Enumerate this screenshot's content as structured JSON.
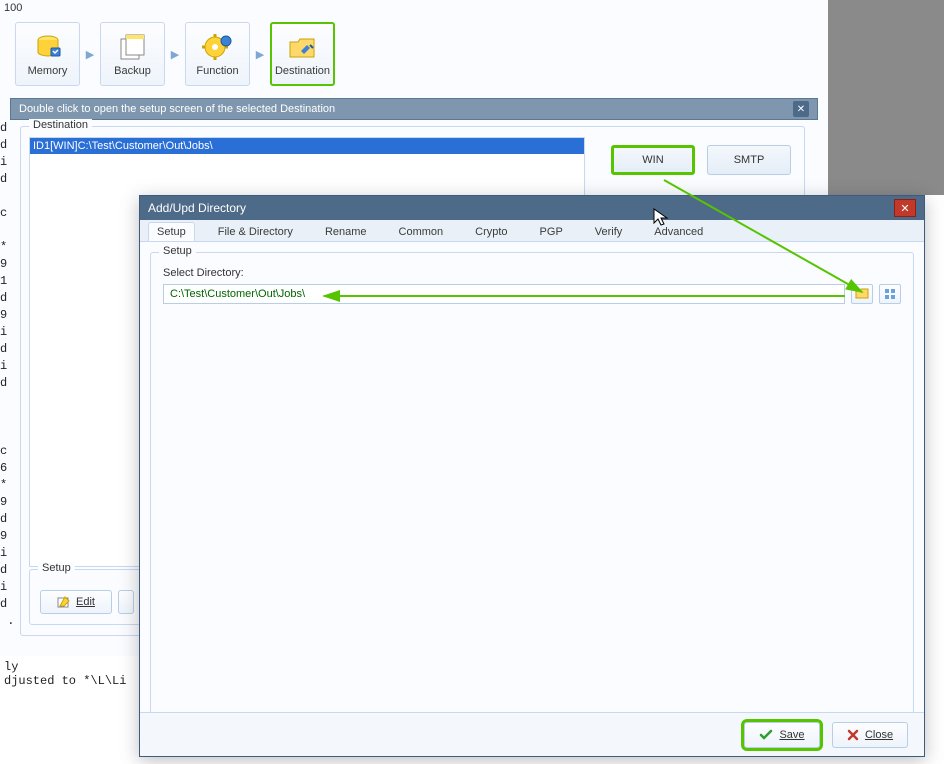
{
  "top_label": "100",
  "toolbar": [
    {
      "label": "Memory"
    },
    {
      "label": "Backup"
    },
    {
      "label": "Function"
    },
    {
      "label": "Destination"
    }
  ],
  "panel_info": "Double click to open the setup screen of the selected Destination",
  "dest_group_legend": "Destination",
  "dest_row": "ID1[WIN]C:\\Test\\Customer\\Out\\Jobs\\",
  "type_buttons": {
    "win": "WIN",
    "smtp": "SMTP"
  },
  "setup_group_legend": "Setup",
  "edit_label": "Edit",
  "dialog": {
    "title": "Add/Upd Directory",
    "tabs": [
      "Setup",
      "File & Directory",
      "Rename",
      "Common",
      "Crypto",
      "PGP",
      "Verify",
      "Advanced"
    ],
    "setup_legend": "Setup",
    "select_dir_label": "Select Directory:",
    "path": "C:\\Test\\Customer\\Out\\Jobs\\",
    "save": "Save",
    "close": "Close"
  },
  "code_line1": "ly",
  "code_line2": "djusted to *\\L\\Li",
  "left_code": "d\nd\ni\nd\n \nc\n \n*\n9\n1\nd\n9\ni\nd\ni\nd\n \n \n \nc\n6\n*\n9\nd\n9\ni\nd\ni\nd\n ."
}
